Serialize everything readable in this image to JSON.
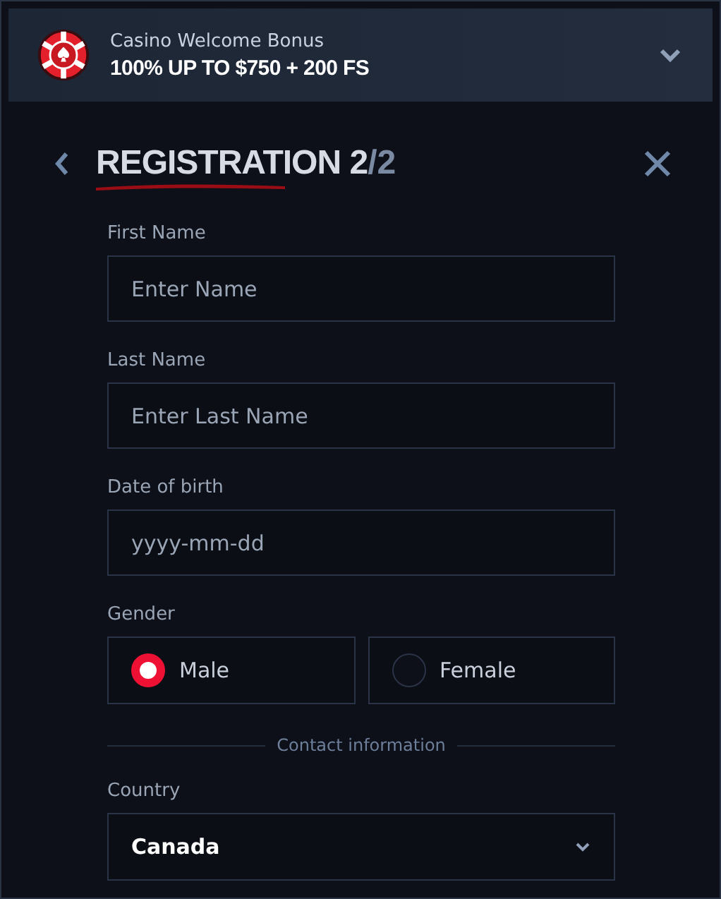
{
  "banner": {
    "subtitle": "Casino Welcome Bonus",
    "headline": "100% UP TO $750 + 200 FS"
  },
  "header": {
    "title": "REGISTRATION",
    "step": "2",
    "total": "/2"
  },
  "fields": [
    {
      "label": "First Name",
      "placeholder": "Enter Name"
    },
    {
      "label": "Last Name",
      "placeholder": "Enter Last Name"
    },
    {
      "label": "Date of birth",
      "placeholder": "yyyy-mm-dd"
    }
  ],
  "gender": {
    "label": "Gender",
    "options": [
      {
        "label": "Male",
        "selected": true
      },
      {
        "label": "Female",
        "selected": false
      }
    ]
  },
  "divider": "Contact information",
  "country": {
    "label": "Country",
    "value": "Canada"
  }
}
